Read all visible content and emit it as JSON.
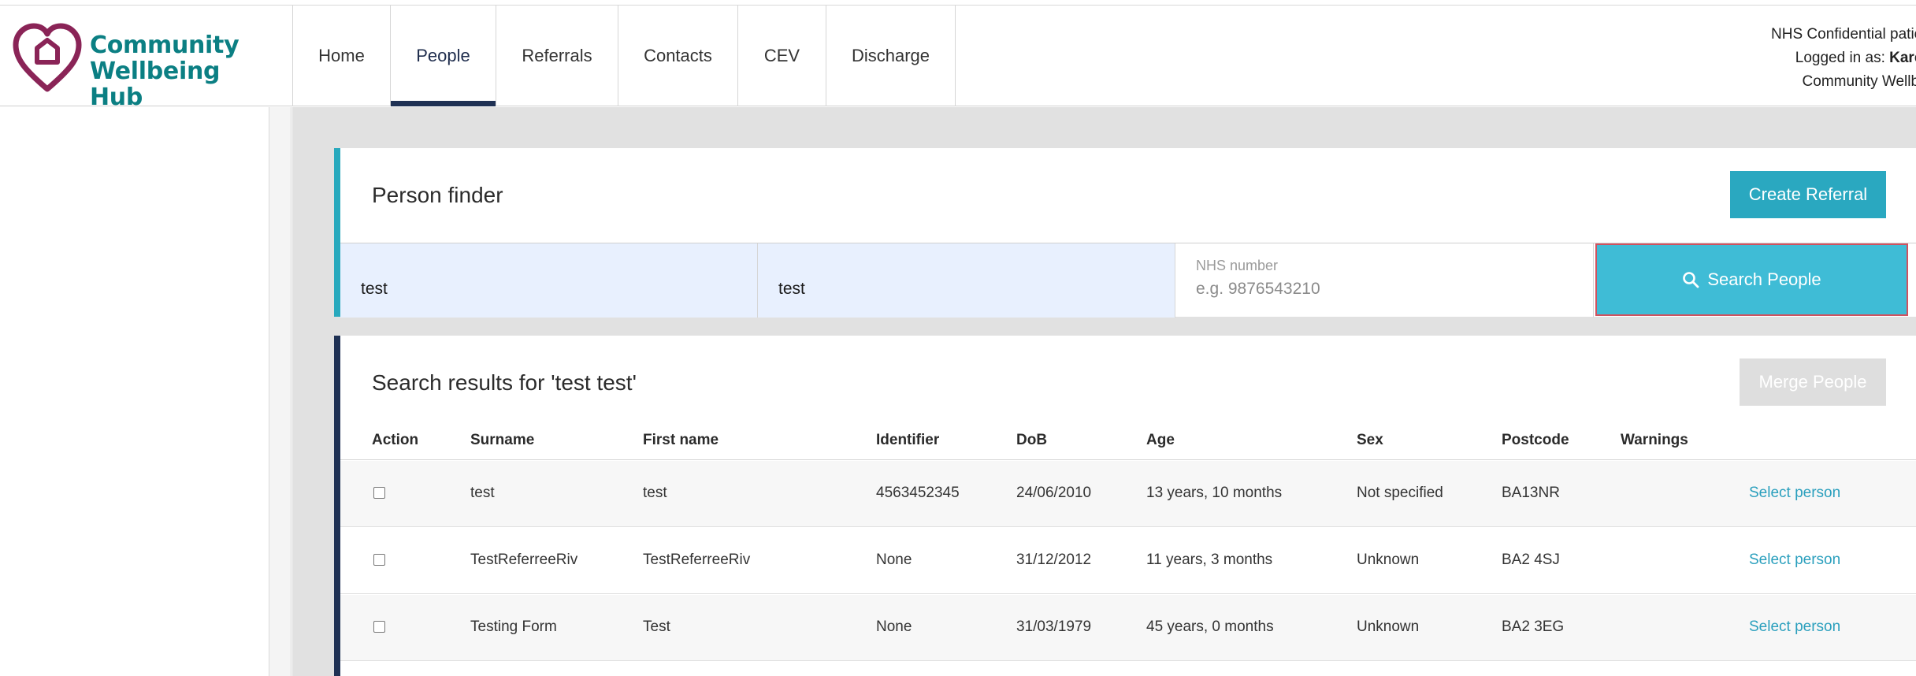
{
  "app": {
    "name_line1": "Community",
    "name_line2": "Wellbeing Hub",
    "brand_color": "#0b7f83",
    "heart_color": "#8a2457"
  },
  "nav": {
    "items": [
      {
        "label": "Home",
        "active": false
      },
      {
        "label": "People",
        "active": true
      },
      {
        "label": "Referrals",
        "active": false
      },
      {
        "label": "Contacts",
        "active": false
      },
      {
        "label": "CEV",
        "active": false
      },
      {
        "label": "Discharge",
        "active": false
      }
    ]
  },
  "user": {
    "confidential": "NHS Confidential patient info",
    "logged_in_prefix": "Logged in as: ",
    "logged_in_name": "Karen",
    "org": "Community Wellbeing"
  },
  "finder": {
    "title": "Person finder",
    "create_label": "Create Referral",
    "surname_value": "test",
    "firstname_value": "test",
    "nhs_label": "NHS number",
    "nhs_placeholder": "e.g. 9876543210",
    "search_label": "Search People",
    "accent": "#28a9bd"
  },
  "results": {
    "title": "Search results for 'test test'",
    "merge_label": "Merge People",
    "headers": {
      "action": "Action",
      "surname": "Surname",
      "firstname": "First name",
      "identifier": "Identifier",
      "dob": "DoB",
      "age": "Age",
      "sex": "Sex",
      "postcode": "Postcode",
      "warnings": "Warnings"
    },
    "rows": [
      {
        "surname": "test",
        "firstname": "test",
        "identifier": "4563452345",
        "dob": "24/06/2010",
        "age": "13 years, 10 months",
        "sex": "Not specified",
        "postcode": "BA13NR",
        "warnings": "",
        "select": "Select person"
      },
      {
        "surname": "TestReferreeRiv",
        "firstname": "TestReferreeRiv",
        "identifier": "None",
        "dob": "31/12/2012",
        "age": "11 years, 3 months",
        "sex": "Unknown",
        "postcode": "BA2 4SJ",
        "warnings": "",
        "select": "Select person"
      },
      {
        "surname": "Testing Form",
        "firstname": "Test",
        "identifier": "None",
        "dob": "31/03/1979",
        "age": "45 years, 0 months",
        "sex": "Unknown",
        "postcode": "BA2 3EG",
        "warnings": "",
        "select": "Select person"
      }
    ]
  }
}
